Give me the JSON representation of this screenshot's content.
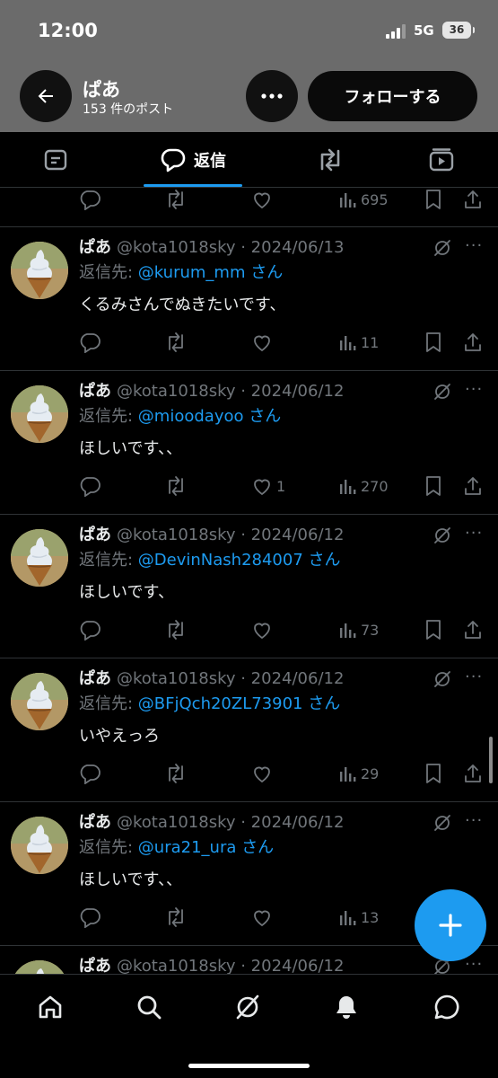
{
  "status_bar": {
    "time": "12:00",
    "network": "5G",
    "battery": "36"
  },
  "profile": {
    "name": "ぱあ",
    "post_count": "153 件のポスト",
    "follow_label": "フォローする"
  },
  "tabs": {
    "reply_label": "返信"
  },
  "top_post": {
    "views": "695"
  },
  "posts": [
    {
      "author": "ぱあ",
      "handle_date": "@kota1018sky · 2024/06/13",
      "reply_prefix": "返信先: ",
      "mention": "@kurum_mm",
      "suffix": " さん",
      "text": "くるみさんでぬきたいです、",
      "likes": "",
      "views": "11"
    },
    {
      "author": "ぱあ",
      "handle_date": "@kota1018sky · 2024/06/12",
      "reply_prefix": "返信先: ",
      "mention": "@mioodayoo",
      "suffix": " さん",
      "text": "ほしいです、、",
      "likes": "1",
      "views": "270"
    },
    {
      "author": "ぱあ",
      "handle_date": "@kota1018sky · 2024/06/12",
      "reply_prefix": "返信先: ",
      "mention": "@DevinNash284007",
      "suffix": " さん",
      "text": "ほしいです、",
      "likes": "",
      "views": "73"
    },
    {
      "author": "ぱあ",
      "handle_date": "@kota1018sky · 2024/06/12",
      "reply_prefix": "返信先: ",
      "mention": "@BFjQch20ZL73901",
      "suffix": " さん",
      "text": "いやえっろ",
      "likes": "",
      "views": "29"
    },
    {
      "author": "ぱあ",
      "handle_date": "@kota1018sky · 2024/06/12",
      "reply_prefix": "返信先: ",
      "mention": "@ura21_ura",
      "suffix": " さん",
      "text": "ほしいです、、",
      "likes": "",
      "views": "13"
    },
    {
      "author": "ぱあ",
      "handle_date": "@kota1018sky · 2024/06/12",
      "reply_prefix": "",
      "mention": "",
      "suffix": "",
      "text": "",
      "likes": "",
      "views": ""
    }
  ]
}
